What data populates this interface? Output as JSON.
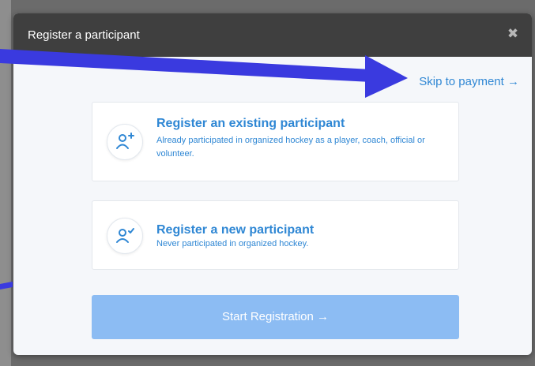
{
  "modal": {
    "title": "Register a participant",
    "close_glyph": "✖",
    "skip_link": "Skip to payment →"
  },
  "options": [
    {
      "title": "Register an existing participant",
      "description": "Already participated in organized hockey as a player, coach, official or volunteer.",
      "icon": "user-plus-icon"
    },
    {
      "title": "Register a new participant",
      "description": "Never participated in organized hockey.",
      "icon": "user-check-icon"
    }
  ],
  "start_button": {
    "label": "Start Registration →"
  },
  "colors": {
    "accent": "#2f87d4",
    "header": "#3f3f3f",
    "button": "#8cbcf3",
    "annotation_arrow": "#3a3adf"
  }
}
